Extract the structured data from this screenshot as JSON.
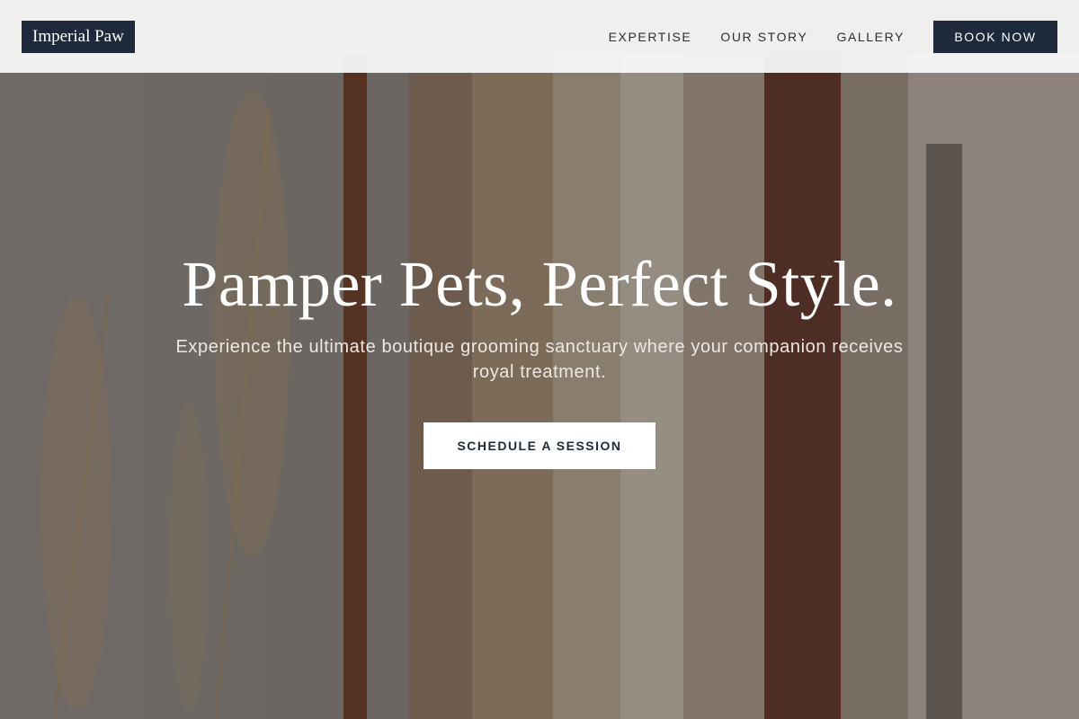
{
  "header": {
    "logo": "Imperial Paw",
    "nav": [
      {
        "label": "EXPERTISE"
      },
      {
        "label": "OUR STORY"
      },
      {
        "label": "GALLERY"
      }
    ],
    "cta_label": "BOOK NOW"
  },
  "hero": {
    "title": "Pamper Pets, Perfect Style.",
    "subtitle": "Experience the ultimate boutique grooming sanctuary where your companion receives royal treatment.",
    "cta_label": "SCHEDULE A SESSION",
    "background": "clothing-rack-photo"
  },
  "colors": {
    "brand_navy": "#1e2a3b",
    "header_bg": "#f8f8f7",
    "text_light": "#ffffff"
  }
}
